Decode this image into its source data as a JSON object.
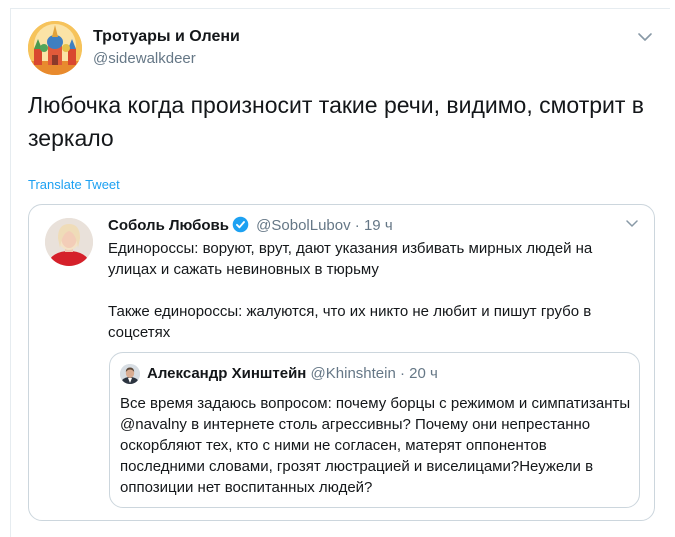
{
  "tweet": {
    "author_name": "Тротуары и Олени",
    "author_handle": "@sidewalkdeer",
    "text": "Любочка когда произносит такие речи, видимо, смотрит в зеркало",
    "translate_label": "Translate Tweet",
    "menu_icon": "chevron-down-icon"
  },
  "quoted_tweet": {
    "author_name": "Соболь Любовь",
    "verified_icon": "verified-badge-icon",
    "author_handle": "@SobolLubov",
    "separator": "·",
    "time": "19 ч",
    "paragraph_1": "Единороссы: воруют, врут, дают указания избивать мирных людей на улицах и сажать невиновных в тюрьму",
    "paragraph_2": "Также единороссы: жалуются, что их никто не любит и пишут грубо в соцсетях",
    "menu_icon": "chevron-down-icon",
    "nested_quote": {
      "author_name": "Александр Хинштейн",
      "author_handle": "@Khinshtein",
      "separator": "·",
      "time": "20 ч",
      "text": "Все время задаюсь вопросом: почему борцы с режимом и симпатизанты @navalny в интернете столь агрессивны? Почему они непрестанно оскорбляют тех, кто с ними не согласен, матерят оппонентов последними словами, грозят люстрацией и виселицами?Неужели в оппозиции нет воспитанных людей?"
    }
  },
  "colors": {
    "text_primary": "#14171a",
    "text_secondary": "#657786",
    "link_blue": "#1da1f2",
    "border": "#ccd6dd"
  }
}
